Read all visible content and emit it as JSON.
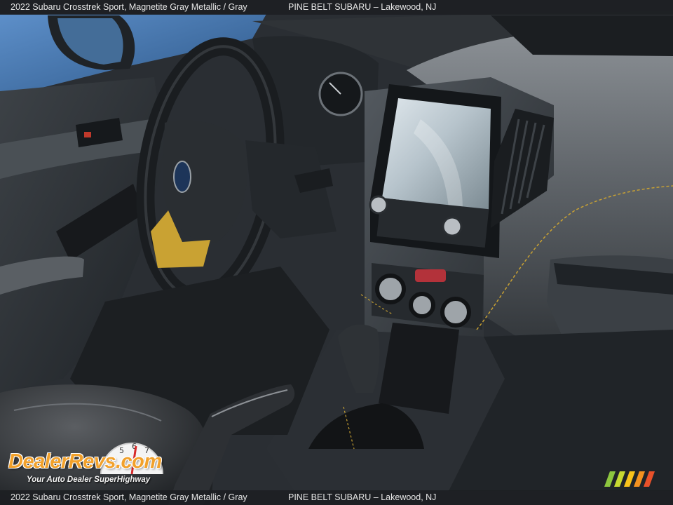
{
  "caption": {
    "vehicle": "2022 Subaru Crosstrek Sport,  Magnetite Gray Metallic / Gray",
    "dealer": "PINE BELT SUBARU – Lakewood, NJ"
  },
  "photo": {
    "alt": "Interior dashboard view of a 2022 Subaru Crosstrek Sport showing steering wheel, infotainment touchscreen, climate controls and gear shifter"
  },
  "watermark": {
    "brand": "DealerRevs.com",
    "tagline": "Your Auto Dealer SuperHighway"
  },
  "colors": {
    "caption_bg": "#1c1e22",
    "caption_text": "#e6e6e6",
    "brand_orange": "#f2a12b",
    "stitching_yellow": "#c9a233",
    "stripes": [
      "#8dc63f",
      "#c7d932",
      "#f7c21b",
      "#f39220",
      "#e9512a"
    ]
  }
}
